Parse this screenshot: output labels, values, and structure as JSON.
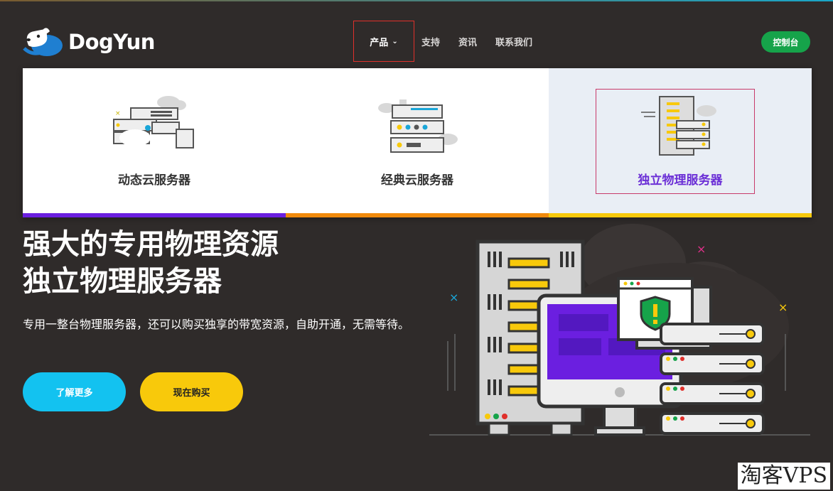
{
  "brand": {
    "name": "DogYun"
  },
  "nav": {
    "items": [
      {
        "label": "产品",
        "active": true
      },
      {
        "label": "支持"
      },
      {
        "label": "资讯"
      },
      {
        "label": "联系我们"
      }
    ],
    "console_label": "控制台"
  },
  "dropdown": {
    "panels": [
      {
        "label": "动态云服务器",
        "accent": "#6b1fe0"
      },
      {
        "label": "经典云服务器",
        "accent": "#f08a0c"
      },
      {
        "label": "独立物理服务器",
        "accent": "#f8c90b",
        "selected": true
      }
    ]
  },
  "hero": {
    "title_line1": "强大的专用物理资源",
    "title_line2": "独立物理服务器",
    "description": "专用一整台物理服务器，还可以购买独享的带宽资源，自助开通，无需等待。",
    "learn_more": "了解更多",
    "buy_now": "现在购买"
  },
  "watermark": "淘客VPS",
  "colors": {
    "background": "#2f2b2a",
    "console": "#16a34a",
    "learn": "#13c2f0",
    "buy": "#f8c90b"
  }
}
